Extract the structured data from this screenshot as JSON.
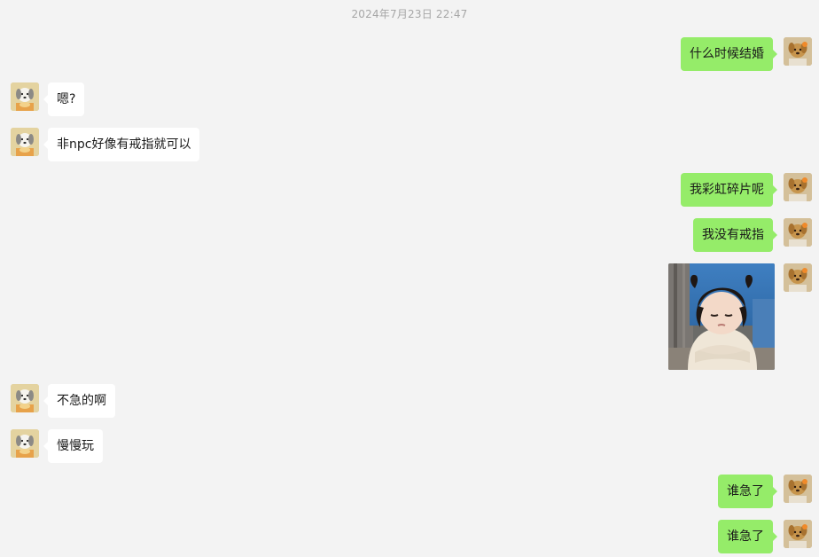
{
  "timestamp": "2024年7月23日 22:47",
  "messages": [
    {
      "side": "out",
      "text": "什么时候结婚"
    },
    {
      "side": "in",
      "text": "嗯?"
    },
    {
      "side": "in",
      "text": "非npc好像有戒指就可以"
    },
    {
      "side": "out",
      "text": "我彩虹碎片呢"
    },
    {
      "side": "out",
      "text": "我没有戒指"
    },
    {
      "side": "out",
      "type": "image",
      "image_subject": "child-in-hoodie-photo"
    },
    {
      "side": "in",
      "text": "不急的啊"
    },
    {
      "side": "in",
      "text": "慢慢玩"
    },
    {
      "side": "out",
      "text": "谁急了"
    },
    {
      "side": "out",
      "text": "谁急了"
    }
  ],
  "colors": {
    "background": "#f3f3f3",
    "outgoing_bubble": "#95ec69",
    "incoming_bubble": "#ffffff",
    "timestamp_text": "#a6a6a6"
  },
  "avatars": {
    "self": "dog-avatar-icon",
    "other": "puppy-avatar-icon"
  }
}
